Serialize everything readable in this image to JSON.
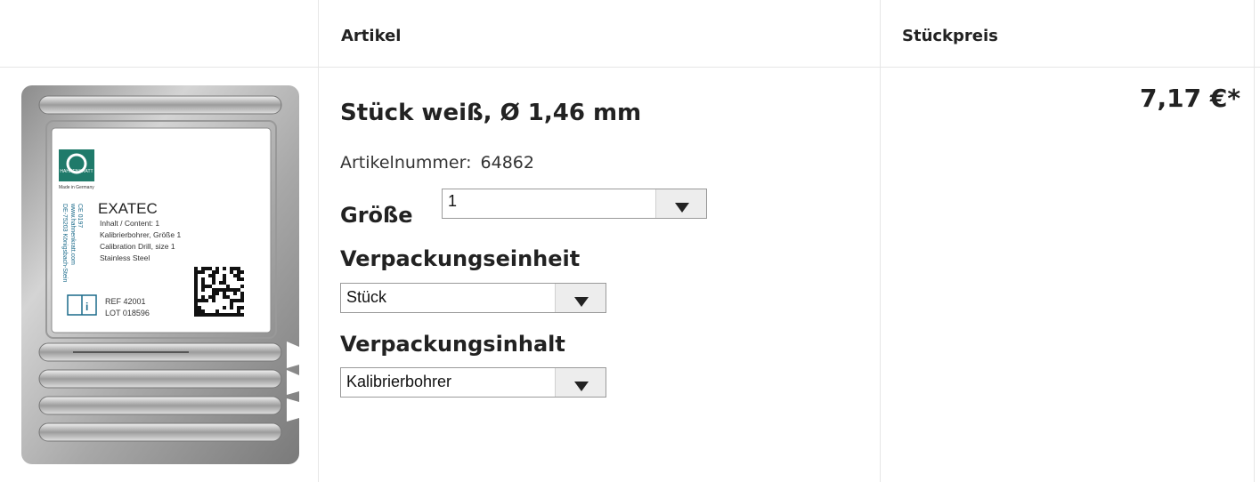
{
  "table": {
    "headers": {
      "artikel": "Artikel",
      "stueckpreis": "Stückpreis"
    }
  },
  "product": {
    "title": "Stück weiß, Ø 1,46 mm",
    "artikelnummer_label": "Artikelnummer:",
    "artikelnummer": "64862",
    "groesse_label": "Größe",
    "groesse_value": "1",
    "verpackungseinheit_label": "Verpackungseinheit",
    "verpackungseinheit_value": "Stück",
    "verpackungsinhalt_label": "Verpackungsinhalt",
    "verpackungsinhalt_value": "Kalibrierbohrer",
    "price": "7,17 €*"
  },
  "image": {
    "brand": "HAHNENKRATT",
    "made_in": "Made in Germany",
    "name": "EXATEC",
    "lines": [
      "Inhalt / Content: 1",
      "Kalibrierbohrer, Größe 1",
      "Calibration Drill, size 1",
      "Stainless Steel"
    ],
    "ref": "REF 42001",
    "lot": "LOT 018596",
    "side_text": [
      "www.hahnenkratt.com",
      "DE-75203 Königsbach-Stein"
    ],
    "ce": "CE 0197"
  },
  "colors": {
    "border": "#e6e6e6",
    "text": "#222222",
    "select_border": "#9a9a9a",
    "foil": "#b9b9b9"
  }
}
